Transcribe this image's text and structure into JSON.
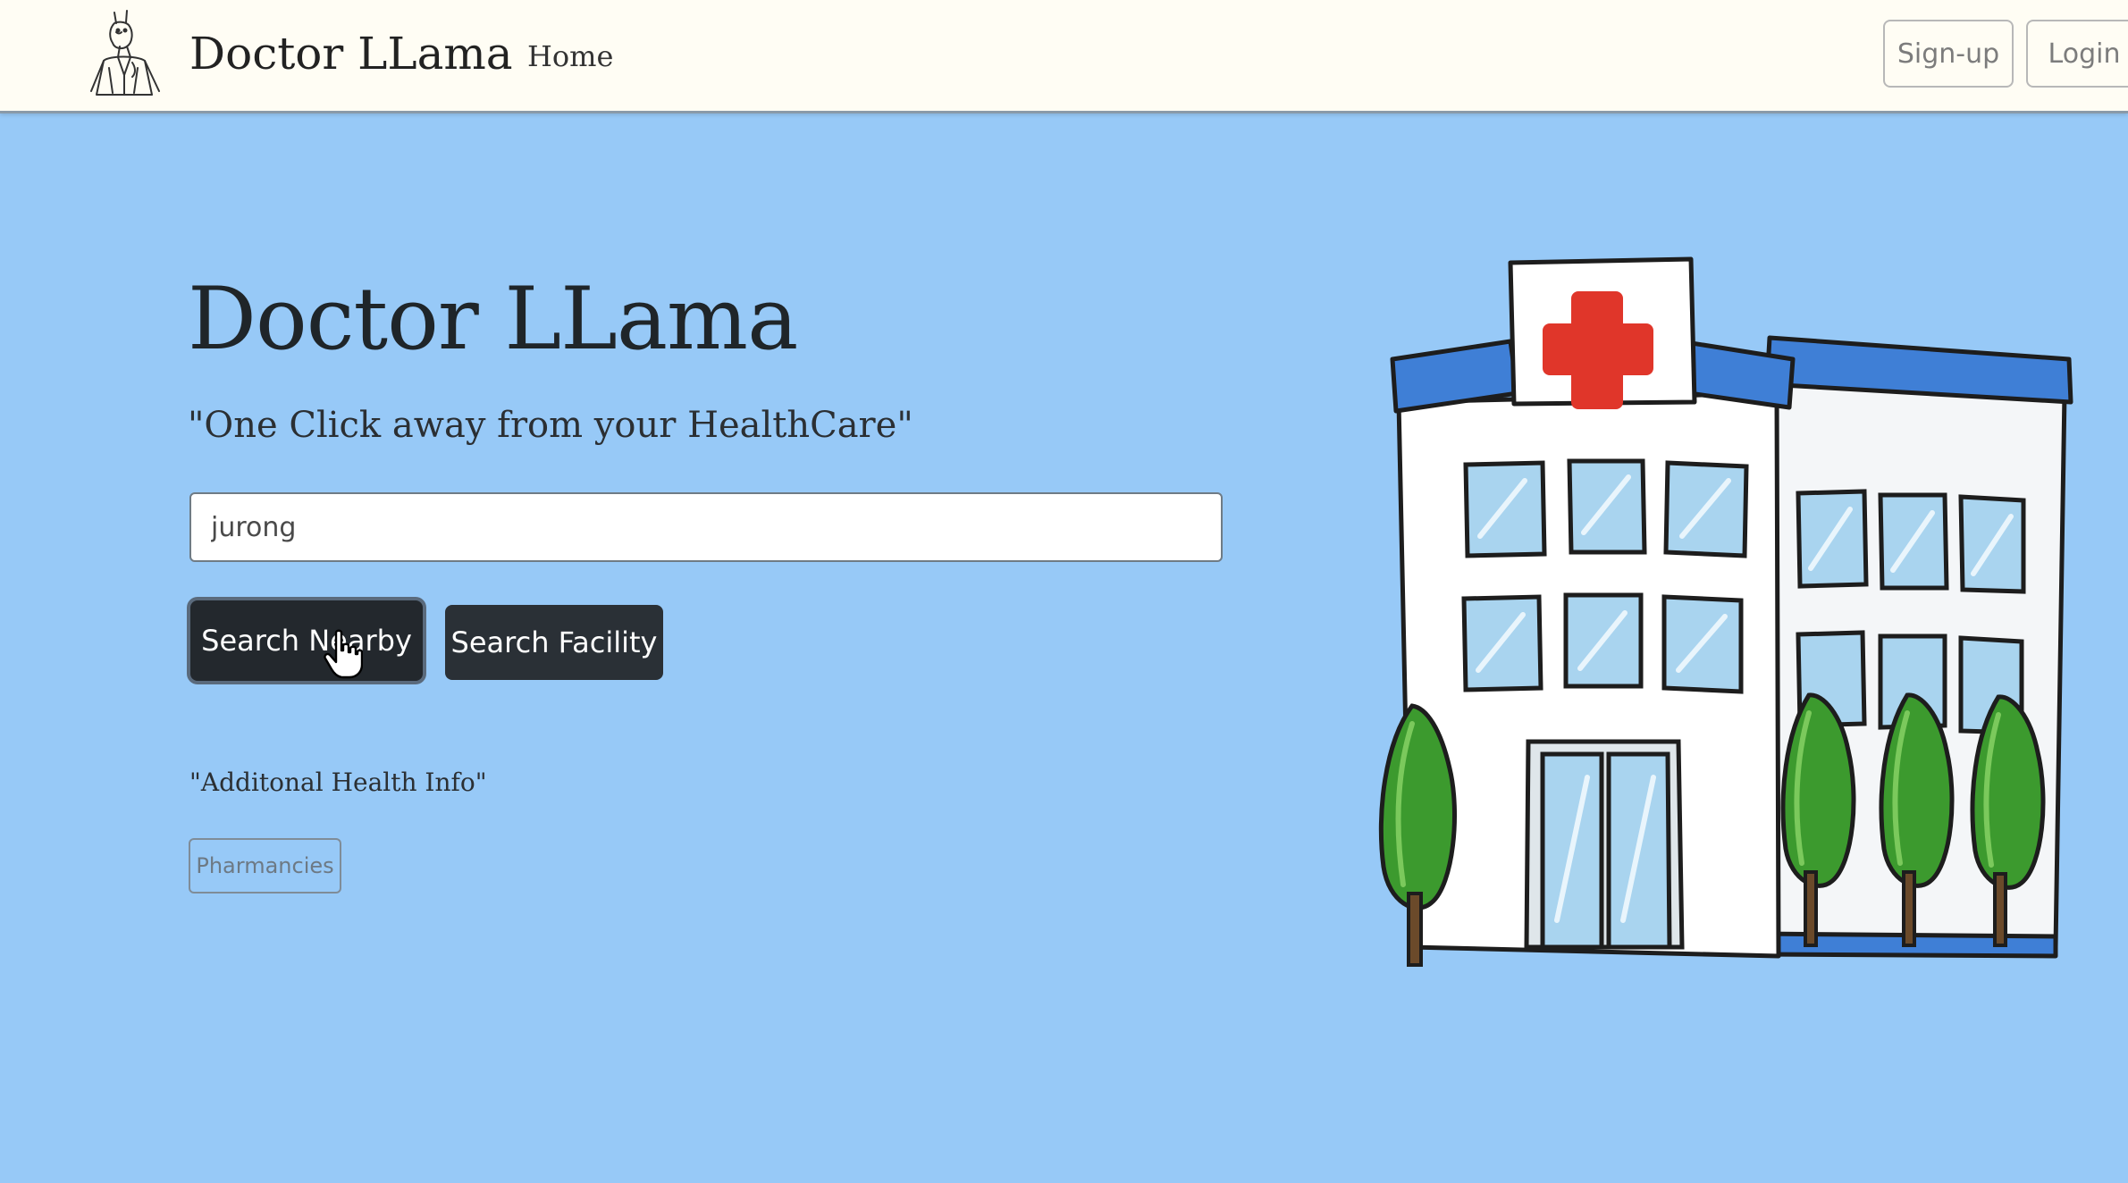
{
  "navbar": {
    "brand": "Doctor LLama",
    "links": [
      {
        "label": "Home"
      }
    ],
    "signup_label": "Sign-up",
    "login_label": "Login",
    "logo_icon": "llama-doctor-logo"
  },
  "hero": {
    "title": "Doctor LLama",
    "subtitle": "\"One Click away from your HealthCare\"",
    "search": {
      "value": "jurong"
    },
    "search_nearby_label": "Search Nearby",
    "search_facility_label": "Search Facility",
    "extra_label": "\"Additonal Health Info\"",
    "pharmacies_label": "Pharmancies"
  },
  "illustration": {
    "icon": "hospital-building-illustration"
  },
  "colors": {
    "page_background": "#97c9f7",
    "navbar_background": "#fffdf4",
    "button_dark": "#2a3036",
    "cross_red": "#e0362a",
    "roof_blue": "#3f7fd6",
    "tree_green": "#3c9a2e"
  }
}
